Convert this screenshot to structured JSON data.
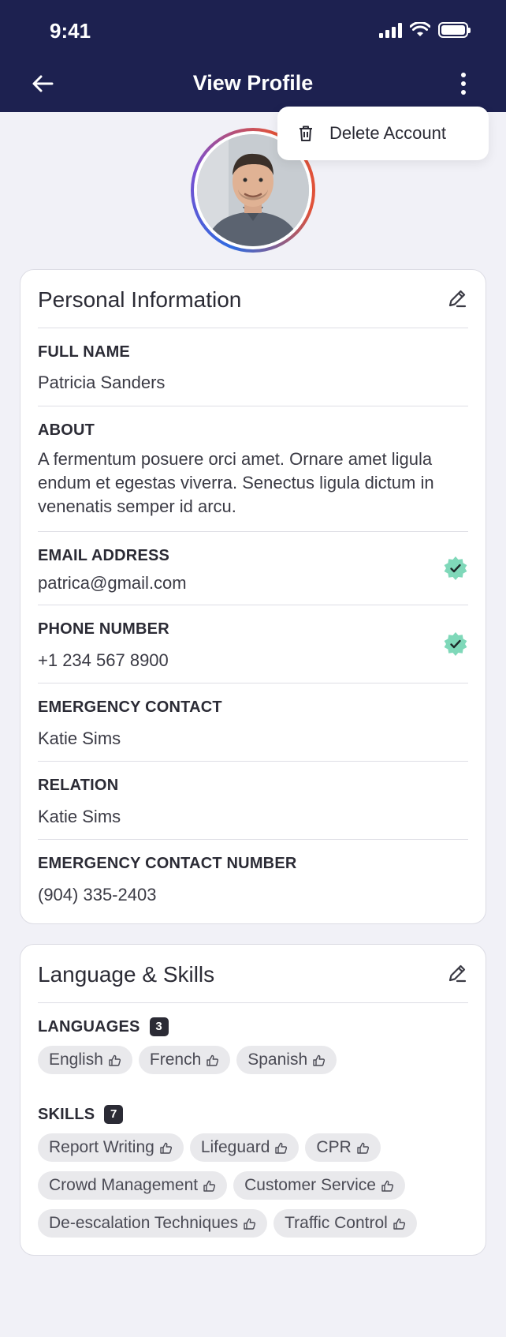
{
  "status_bar": {
    "time": "9:41"
  },
  "header": {
    "title": "View Profile"
  },
  "menu": {
    "delete_label": "Delete Account"
  },
  "personal": {
    "title": "Personal Information",
    "full_name_label": "FULL NAME",
    "full_name": "Patricia Sanders",
    "about_label": "ABOUT",
    "about": "A fermentum posuere orci amet. Ornare amet ligula endum et egestas viverra. Senectus ligula dictum in venenatis semper id arcu.",
    "email_label": "EMAIL ADDRESS",
    "email": "patrica@gmail.com",
    "phone_label": "PHONE NUMBER",
    "phone": "+1 234 567 8900",
    "emergency_label": "EMERGENCY CONTACT",
    "emergency": "Katie Sims",
    "relation_label": "RELATION",
    "relation": "Katie Sims",
    "emergency_number_label": "EMERGENCY CONTACT NUMBER",
    "emergency_number": "(904) 335-2403"
  },
  "skills_card": {
    "title": "Language & Skills",
    "languages_label": "LANGUAGES",
    "languages_count": "3",
    "languages": [
      "English",
      "French",
      "Spanish"
    ],
    "skills_label": "SKILLS",
    "skills_count": "7",
    "skills": [
      "Report Writing",
      "Lifeguard",
      "CPR",
      "Crowd Management",
      "Customer Service",
      "De-escalation Techniques",
      "Traffic Control"
    ]
  },
  "colors": {
    "header_bg": "#1d2150",
    "verified": "#7fd8b9",
    "background": "#f1f1f7"
  }
}
